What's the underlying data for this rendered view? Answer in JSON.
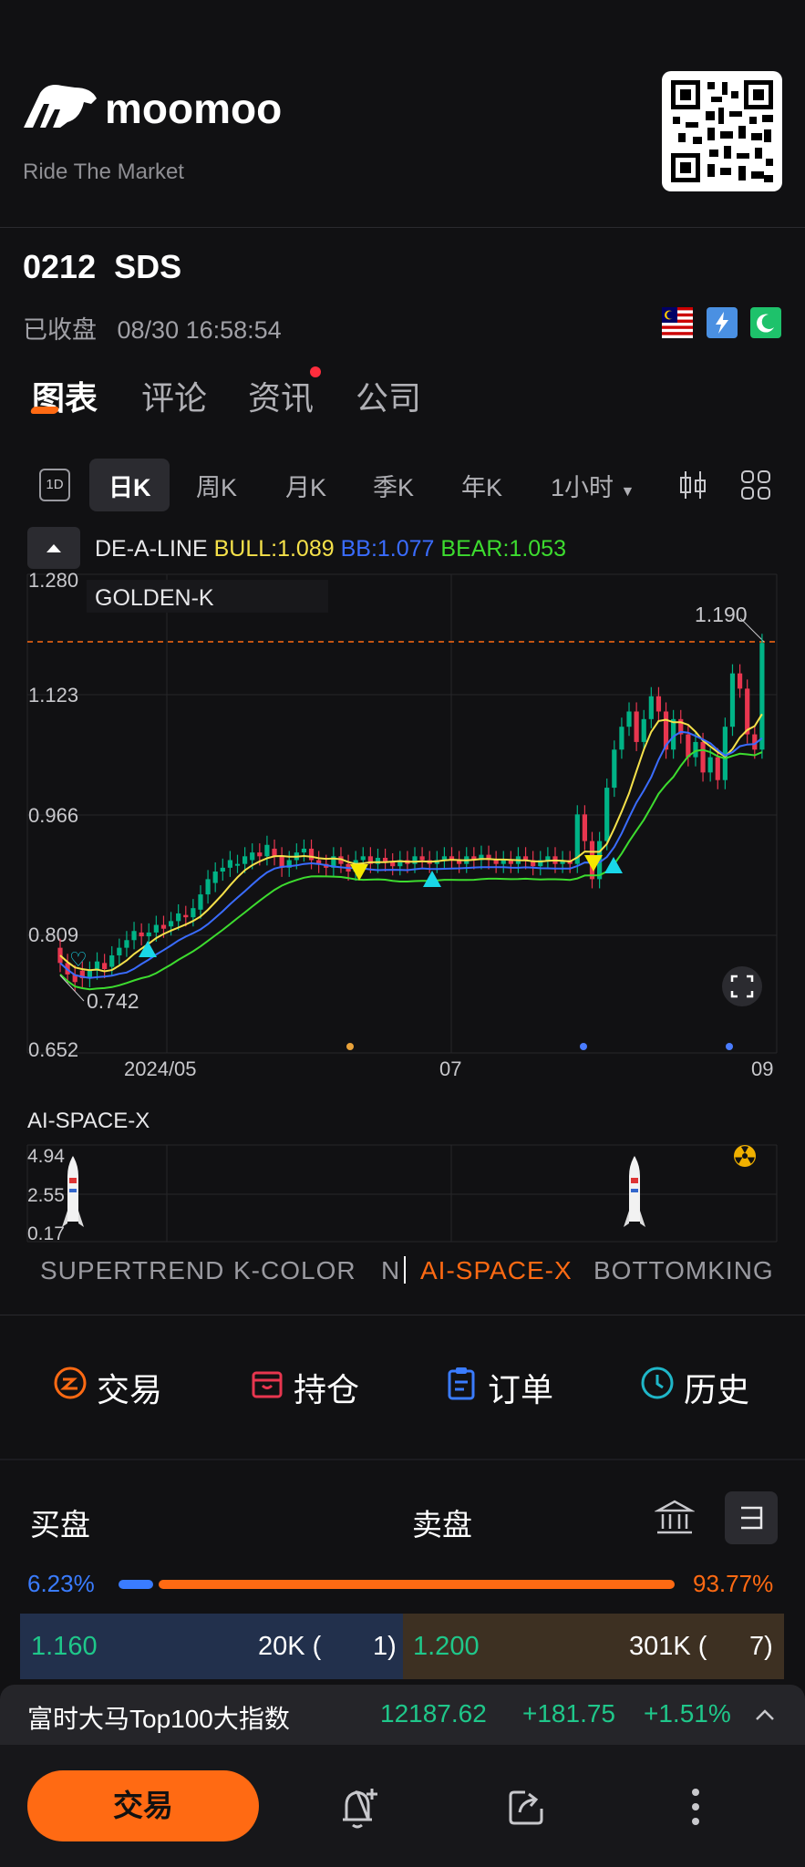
{
  "brand": {
    "name": "moomoo",
    "slogan": "Ride The Market"
  },
  "stock": {
    "code": "0212",
    "name": "SDS",
    "status": "已收盘",
    "timestamp": "08/30 16:58:54"
  },
  "tabs": [
    "图表",
    "评论",
    "资讯",
    "公司"
  ],
  "periods": [
    "1D",
    "日K",
    "周K",
    "月K",
    "季K",
    "年K",
    "1小时"
  ],
  "legend": {
    "indicator": "DE-A-LINE",
    "bull": "BULL:1.089",
    "bb": "BB:1.077",
    "bear": "BEAR:1.053",
    "overlay": "GOLDEN-K"
  },
  "colors": {
    "up": "#00b386",
    "down": "#e8364f",
    "accent": "#ff6a13",
    "bull": "#f5e14a",
    "bb": "#3a6cff",
    "bear": "#3ddc2f",
    "signal_up": "#19d7e8",
    "signal_down": "#f5e800"
  },
  "chart_data": {
    "type": "candlestick",
    "y_ticks": [
      "1.280",
      "1.123",
      "0.966",
      "0.809",
      "0.652"
    ],
    "x_ticks": [
      "2024/05",
      "07",
      "09"
    ],
    "ylim": [
      0.652,
      1.28
    ],
    "price_line": "1.190",
    "low_label": "0.742",
    "candles": [
      [
        0.79,
        0.77
      ],
      [
        0.77,
        0.755
      ],
      [
        0.755,
        0.745
      ],
      [
        0.76,
        0.75
      ],
      [
        0.75,
        0.76
      ],
      [
        0.76,
        0.772
      ],
      [
        0.77,
        0.762
      ],
      [
        0.765,
        0.78
      ],
      [
        0.78,
        0.79
      ],
      [
        0.79,
        0.8
      ],
      [
        0.8,
        0.812
      ],
      [
        0.81,
        0.805
      ],
      [
        0.805,
        0.81
      ],
      [
        0.81,
        0.82
      ],
      [
        0.82,
        0.815
      ],
      [
        0.818,
        0.825
      ],
      [
        0.825,
        0.835
      ],
      [
        0.833,
        0.83
      ],
      [
        0.83,
        0.842
      ],
      [
        0.84,
        0.86
      ],
      [
        0.86,
        0.88
      ],
      [
        0.875,
        0.89
      ],
      [
        0.89,
        0.895
      ],
      [
        0.895,
        0.905
      ],
      [
        0.9,
        0.9
      ],
      [
        0.9,
        0.91
      ],
      [
        0.905,
        0.915
      ],
      [
        0.915,
        0.91
      ],
      [
        0.91,
        0.925
      ],
      [
        0.92,
        0.91
      ],
      [
        0.91,
        0.895
      ],
      [
        0.895,
        0.905
      ],
      [
        0.905,
        0.915
      ],
      [
        0.915,
        0.92
      ],
      [
        0.92,
        0.905
      ],
      [
        0.905,
        0.9
      ],
      [
        0.9,
        0.895
      ],
      [
        0.895,
        0.91
      ],
      [
        0.91,
        0.9
      ],
      [
        0.9,
        0.89
      ],
      [
        0.89,
        0.905
      ],
      [
        0.905,
        0.91
      ],
      [
        0.91,
        0.9
      ],
      [
        0.9,
        0.908
      ],
      [
        0.908,
        0.902
      ],
      [
        0.902,
        0.897
      ],
      [
        0.897,
        0.905
      ],
      [
        0.905,
        0.9
      ],
      [
        0.9,
        0.91
      ],
      [
        0.91,
        0.905
      ],
      [
        0.905,
        0.9
      ],
      [
        0.9,
        0.905
      ],
      [
        0.905,
        0.91
      ],
      [
        0.91,
        0.905
      ],
      [
        0.905,
        0.9
      ],
      [
        0.9,
        0.91
      ],
      [
        0.91,
        0.905
      ],
      [
        0.905,
        0.912
      ],
      [
        0.912,
        0.905
      ],
      [
        0.905,
        0.9
      ],
      [
        0.9,
        0.905
      ],
      [
        0.905,
        0.9
      ],
      [
        0.9,
        0.91
      ],
      [
        0.91,
        0.905
      ],
      [
        0.905,
        0.897
      ],
      [
        0.897,
        0.905
      ],
      [
        0.905,
        0.91
      ],
      [
        0.91,
        0.9
      ],
      [
        0.9,
        0.905
      ],
      [
        0.905,
        0.9
      ],
      [
        0.9,
        0.965
      ],
      [
        0.965,
        0.93
      ],
      [
        0.93,
        0.88
      ],
      [
        0.88,
        0.93
      ],
      [
        0.93,
        1.0
      ],
      [
        1.0,
        1.05
      ],
      [
        1.05,
        1.08
      ],
      [
        1.08,
        1.1
      ],
      [
        1.1,
        1.06
      ],
      [
        1.06,
        1.09
      ],
      [
        1.09,
        1.12
      ],
      [
        1.12,
        1.1
      ],
      [
        1.1,
        1.05
      ],
      [
        1.05,
        1.09
      ],
      [
        1.09,
        1.07
      ],
      [
        1.07,
        1.04
      ],
      [
        1.04,
        1.06
      ],
      [
        1.06,
        1.02
      ],
      [
        1.02,
        1.04
      ],
      [
        1.04,
        1.01
      ],
      [
        1.01,
        1.08
      ],
      [
        1.08,
        1.15
      ],
      [
        1.15,
        1.13
      ],
      [
        1.13,
        1.07
      ],
      [
        1.07,
        1.05
      ],
      [
        1.05,
        1.19
      ]
    ]
  },
  "sub_chart": {
    "name": "AI-SPACE-X",
    "y_ticks": [
      "4.94",
      "2.55",
      "0.17"
    ]
  },
  "indicator_tabs": [
    "SUPERTREND",
    "K-COLOR",
    "N",
    "AI-SPACE-X",
    "BOTTOMKING"
  ],
  "actions": [
    "交易",
    "持仓",
    "订单",
    "历史"
  ],
  "order_book": {
    "bid_title": "买盘",
    "ask_title": "卖盘",
    "bid_pct": "6.23%",
    "ask_pct": "93.77%",
    "bid_ratio": 0.0623,
    "bid_price": "1.160",
    "bid_vol": "20K (",
    "bid_cnt": "1)",
    "ask_price": "1.200",
    "ask_vol": "301K (",
    "ask_cnt": "7)"
  },
  "index_ticker": {
    "name": "富时大马Top100大指数",
    "value": "12187.62",
    "change": "+181.75",
    "pct": "+1.51%"
  },
  "bottom": {
    "trade_label": "交易"
  }
}
